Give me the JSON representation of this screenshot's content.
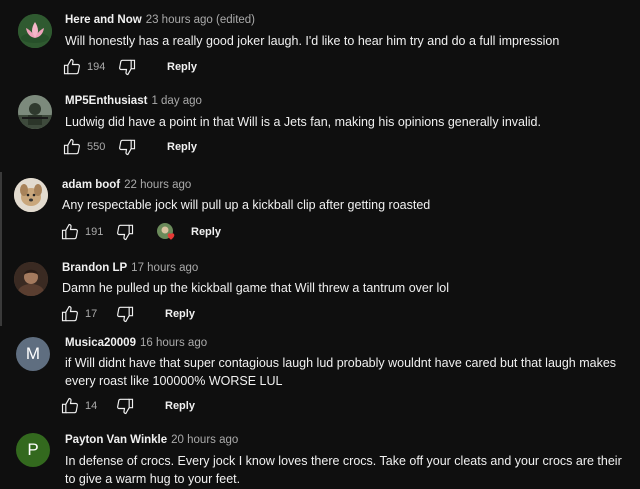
{
  "comments": [
    {
      "author": "Here and Now",
      "meta": "23 hours ago (edited)",
      "lines": [
        "Will honestly has a really good joker laugh. I'd like to hear him try and do a full impression"
      ],
      "likes": "194",
      "reply": "Reply",
      "avatar": {
        "type": "image",
        "icon": "lotus-avatar-icon",
        "color": "#3b6b3a"
      }
    },
    {
      "author": "MP5Enthusiast",
      "meta": "1 day ago",
      "lines": [
        "Ludwig did have a point in that Will is a Jets fan, making his opinions generally invalid."
      ],
      "likes": "550",
      "reply": "Reply",
      "avatar": {
        "type": "image",
        "icon": "soldier-avatar-icon",
        "color": "#4a5a4a"
      }
    },
    {
      "author": "adam boof",
      "meta": "22 hours ago",
      "lines": [
        "Any respectable jock will pull up a kickball clip after getting roasted"
      ],
      "likes": "191",
      "reply": "Reply",
      "avatar": {
        "type": "image",
        "icon": "dog-avatar-icon",
        "color": "#d8cfc0"
      }
    },
    {
      "author": "Brandon LP",
      "meta": "17 hours ago",
      "lines": [
        "Damn he pulled up the kickball game that Will threw a tantrum over lol"
      ],
      "likes": "17",
      "reply": "Reply",
      "avatar": {
        "type": "image",
        "icon": "person-avatar-icon",
        "color": "#6b4a3a"
      }
    },
    {
      "author": "Musica20009",
      "meta": "16 hours ago",
      "lines": [
        "if Will didnt have that super contagious laugh lud probably wouldnt have cared but that laugh makes",
        "every roast like 100000% WORSE LUL"
      ],
      "likes": "14",
      "reply": "Reply",
      "avatar": {
        "type": "letter",
        "letter": "M",
        "color": "#5f6e80"
      }
    },
    {
      "author": "Payton Van Winkle",
      "meta": "20 hours ago",
      "lines": [
        "In defense of crocs. Every jock I know loves there crocs. Take off your cleats and your crocs are their",
        "to give a warm hug to your feet."
      ],
      "likes": "",
      "reply": "",
      "avatar": {
        "type": "letter",
        "letter": "P",
        "color": "#33691e"
      }
    }
  ],
  "colors": {
    "background": "#0f0f0f",
    "text": "#f1f1f1",
    "muted": "#aaaaaa",
    "heart": "#e53935"
  }
}
